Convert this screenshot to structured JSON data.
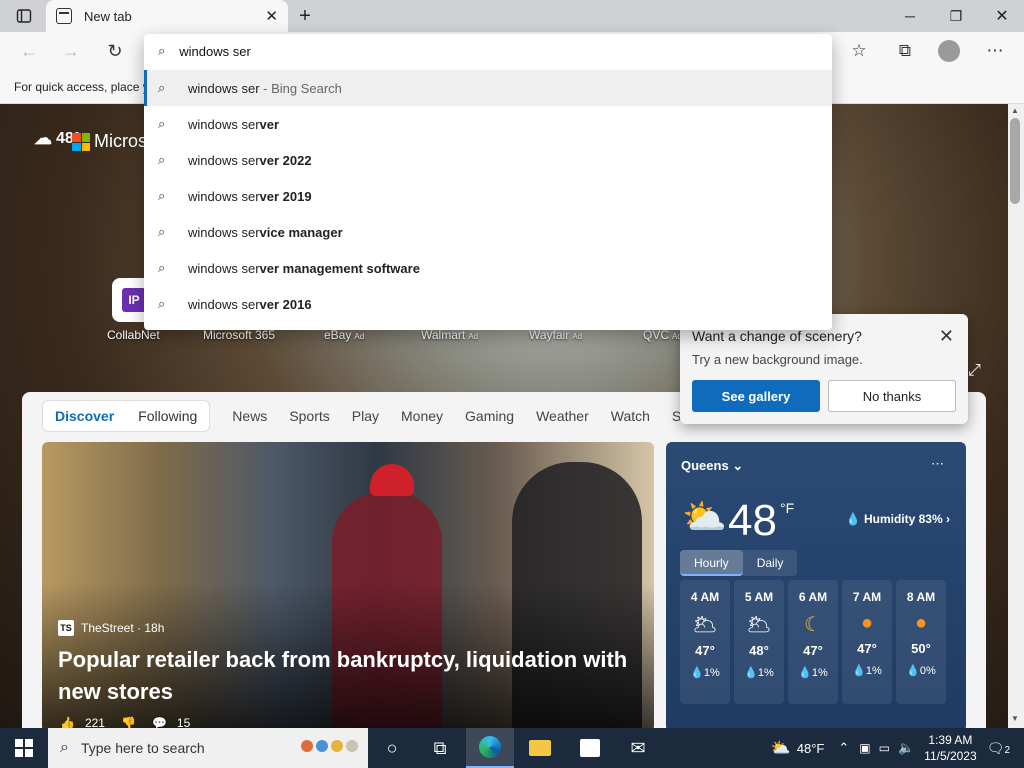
{
  "browser": {
    "tab_title": "New tab",
    "favorites_bar_text": "For quick access, place y"
  },
  "omnibox": {
    "query": "windows ser",
    "suggestions": [
      {
        "prefix": "windows ser",
        "rest": "",
        "hint": " - Bing Search"
      },
      {
        "prefix": "windows ser",
        "rest": "ver",
        "hint": ""
      },
      {
        "prefix": "windows ser",
        "rest": "ver 2022",
        "hint": ""
      },
      {
        "prefix": "windows ser",
        "rest": "ver 2019",
        "hint": ""
      },
      {
        "prefix": "windows ser",
        "rest": "vice manager",
        "hint": ""
      },
      {
        "prefix": "windows ser",
        "rest": "ver management software",
        "hint": ""
      },
      {
        "prefix": "windows ser",
        "rest": "ver 2016",
        "hint": ""
      }
    ]
  },
  "ntp": {
    "weather_temp": "48°",
    "brand_text": "Micros",
    "quick_links": [
      {
        "label": "CollabNet",
        "ad": "",
        "tile": "IP"
      },
      {
        "label": "Microsoft 365",
        "ad": ""
      },
      {
        "label": "eBay",
        "ad": "Ad"
      },
      {
        "label": "Walmart",
        "ad": "Ad"
      },
      {
        "label": "Wayfair",
        "ad": "Ad"
      },
      {
        "label": "QVC",
        "ad": "Ad"
      }
    ]
  },
  "scenery_popup": {
    "title": "Want a change of scenery?",
    "subtitle": "Try a new background image.",
    "primary": "See gallery",
    "secondary": "No thanks"
  },
  "feed": {
    "segment": [
      "Discover",
      "Following"
    ],
    "tabs": [
      "News",
      "Sports",
      "Play",
      "Money",
      "Gaming",
      "Weather",
      "Watch",
      "S"
    ],
    "hero": {
      "source": "TheStreet · 18h",
      "source_logo": "TS",
      "headline": "Popular retailer back from bankruptcy, liquidation with new stores",
      "likes": "221",
      "comments": "15"
    }
  },
  "weather": {
    "location": "Queens",
    "temp": "48",
    "unit": "°F",
    "humidity": "Humidity 83%",
    "modes": [
      "Hourly",
      "Daily"
    ],
    "hourly": [
      {
        "time": "4 AM",
        "icon": "moon-cloud-icon",
        "temp": "47°",
        "precip": "1%"
      },
      {
        "time": "5 AM",
        "icon": "moon-cloud-icon",
        "temp": "48°",
        "precip": "1%"
      },
      {
        "time": "6 AM",
        "icon": "moon-icon",
        "temp": "47°",
        "precip": "1%"
      },
      {
        "time": "7 AM",
        "icon": "sun-icon",
        "temp": "47°",
        "precip": "1%"
      },
      {
        "time": "8 AM",
        "icon": "sun-icon",
        "temp": "50°",
        "precip": "0%"
      }
    ]
  },
  "taskbar": {
    "search_placeholder": "Type here to search",
    "weather": "48°F",
    "time": "1:39 AM",
    "date": "11/5/2023",
    "notifications": "2"
  },
  "colors": {
    "accent": "#0f6cbd",
    "taskbar": "#1c2a3d",
    "weather_card": "#1f3b63"
  }
}
